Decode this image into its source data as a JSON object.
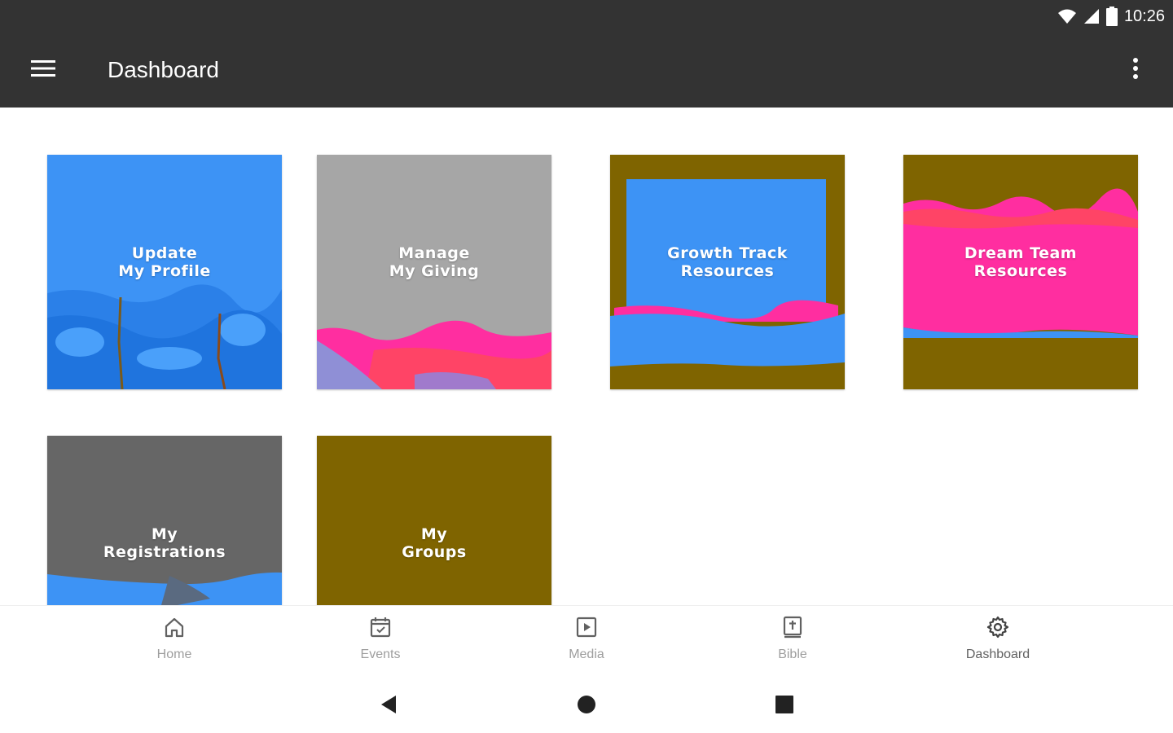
{
  "status_bar": {
    "time": "10:26",
    "icons": [
      "wifi-icon",
      "signal-icon",
      "battery-icon"
    ]
  },
  "app_bar": {
    "title": "Dashboard",
    "icons": [
      "menu-icon",
      "overflow-menu-icon"
    ]
  },
  "tiles": [
    {
      "line1": "Update",
      "line2": "My Profile",
      "color": "#3d93f5"
    },
    {
      "line1": "Manage",
      "line2": "My Giving",
      "color": "#a6a6a6"
    },
    {
      "line1": "Growth Track",
      "line2": "Resources",
      "color": "#7f6400"
    },
    {
      "line1": "Dream Team",
      "line2": "Resources",
      "color": "#ff2ea0"
    },
    {
      "line1": "My",
      "line2": "Registrations",
      "color": "#666666"
    },
    {
      "line1": "My",
      "line2": "Groups",
      "color": "#7f6400"
    }
  ],
  "bottom_nav": {
    "items": [
      {
        "label": "Home",
        "icon": "home-icon"
      },
      {
        "label": "Events",
        "icon": "calendar-icon"
      },
      {
        "label": "Media",
        "icon": "play-icon"
      },
      {
        "label": "Bible",
        "icon": "bible-icon"
      },
      {
        "label": "Dashboard",
        "icon": "gear-icon",
        "active": true
      }
    ]
  },
  "system_nav": {
    "icons": [
      "back-icon",
      "home-circle-icon",
      "recents-icon"
    ]
  },
  "colors": {
    "app_bar": "#333333",
    "nav_inactive": "#9e9e9e",
    "nav_active": "#616161"
  }
}
